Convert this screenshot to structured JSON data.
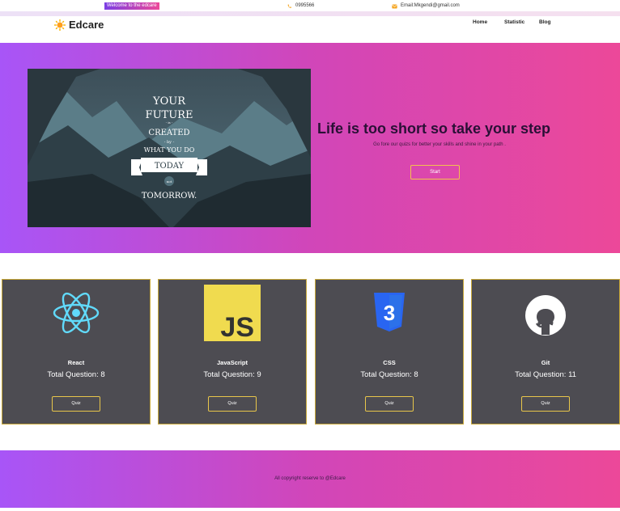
{
  "topbar": {
    "welcome": "Welcome to the edcare",
    "phone": "0995566",
    "email": "Email:Mkgendi@gmail.com"
  },
  "header": {
    "brand": "Edcare",
    "nav": [
      "Home",
      "Statistic",
      "Blog"
    ]
  },
  "hero": {
    "poster_lines": [
      "YOUR",
      "FUTURE",
      "- is -",
      "CREATED",
      "- by -",
      "WHAT YOU DO",
      "TODAY",
      "not",
      "TOMORROW."
    ],
    "title": "Life is too short so take your step",
    "subtitle": "Go fore our quizs for better your skills and shine in your path .",
    "button": "Start"
  },
  "cards": [
    {
      "title": "React",
      "count_text": "Total Question: 8",
      "button": "Quiz",
      "icon": "react-logo-icon"
    },
    {
      "title": "JavaScript",
      "count_text": "Total Question: 9",
      "button": "Quiz",
      "icon": "javascript-logo-icon",
      "logo_text": "JS"
    },
    {
      "title": "CSS",
      "count_text": "Total Question: 8",
      "button": "Quiz",
      "icon": "css3-logo-icon",
      "logo_text": "3"
    },
    {
      "title": "Git",
      "count_text": "Total Question: 11",
      "button": "Quiz",
      "icon": "github-logo-icon"
    }
  ],
  "footer": {
    "text": "All copyright reserve to @Edcare"
  },
  "colors": {
    "gradient_start": "#a855f7",
    "gradient_end": "#ec4899",
    "card_bg": "#4d4c52",
    "card_border": "#c9a93a",
    "js_yellow": "#f0db4f",
    "css_blue": "#2965f1",
    "react_cyan": "#61dafb"
  }
}
